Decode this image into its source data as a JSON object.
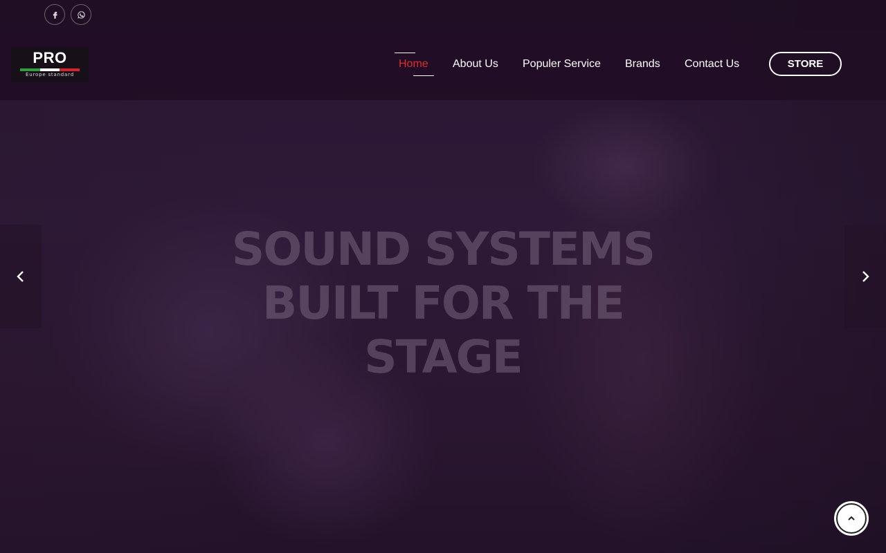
{
  "social": {
    "facebook_icon": "facebook-icon",
    "whatsapp_icon": "whatsapp-icon"
  },
  "logo": {
    "text": "PRO",
    "subtitle": "Europe standard",
    "flag_colors": [
      "#2e9e3e",
      "#ffffff",
      "#d9232a"
    ]
  },
  "nav": {
    "items": [
      {
        "label": "Home",
        "active": true
      },
      {
        "label": "About Us",
        "active": false
      },
      {
        "label": "Populer Service",
        "active": false
      },
      {
        "label": "Brands",
        "active": false
      },
      {
        "label": "Contact Us",
        "active": false
      }
    ],
    "store_label": "STORE",
    "active_color": "#e02b2b"
  },
  "hero": {
    "title_lines": [
      "SOUND SYSTEMS",
      "BUILT FOR THE",
      "STAGE"
    ],
    "prev_icon": "chevron-left-icon",
    "next_icon": "chevron-right-icon"
  },
  "back_to_top_icon": "chevron-up-icon"
}
